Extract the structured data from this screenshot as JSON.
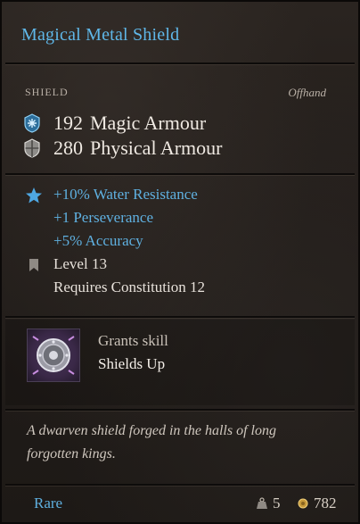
{
  "item": {
    "name": "Magical Metal Shield",
    "category": "SHIELD",
    "slot": "Offhand",
    "magic_armour": {
      "value": "192",
      "label": "Magic Armour"
    },
    "physical_armour": {
      "value": "280",
      "label": "Physical Armour"
    },
    "bonuses": [
      "+10% Water Resistance",
      "+1 Perseverance",
      "+5% Accuracy"
    ],
    "level": "Level 13",
    "requirement": "Requires Constitution 12",
    "skill": {
      "grants_label": "Grants skill",
      "name": "Shields Up",
      "icon": "shields-up-skill-icon"
    },
    "description": "A dwarven shield forged in the halls of long forgotten kings.",
    "rarity": "Rare",
    "weight": "5",
    "value": "782"
  },
  "colors": {
    "title": "#5fb7e8",
    "bonus": "#5fb0e0",
    "rarity": "#5fb0e0",
    "text": "#efe9e2",
    "background": "#221d1a"
  },
  "icons": {
    "magic_armour": "magic-armour-icon",
    "physical_armour": "physical-armour-icon",
    "bonus": "star-icon",
    "level": "bookmark-icon",
    "weight": "weight-icon",
    "gold": "gold-coin-icon"
  }
}
